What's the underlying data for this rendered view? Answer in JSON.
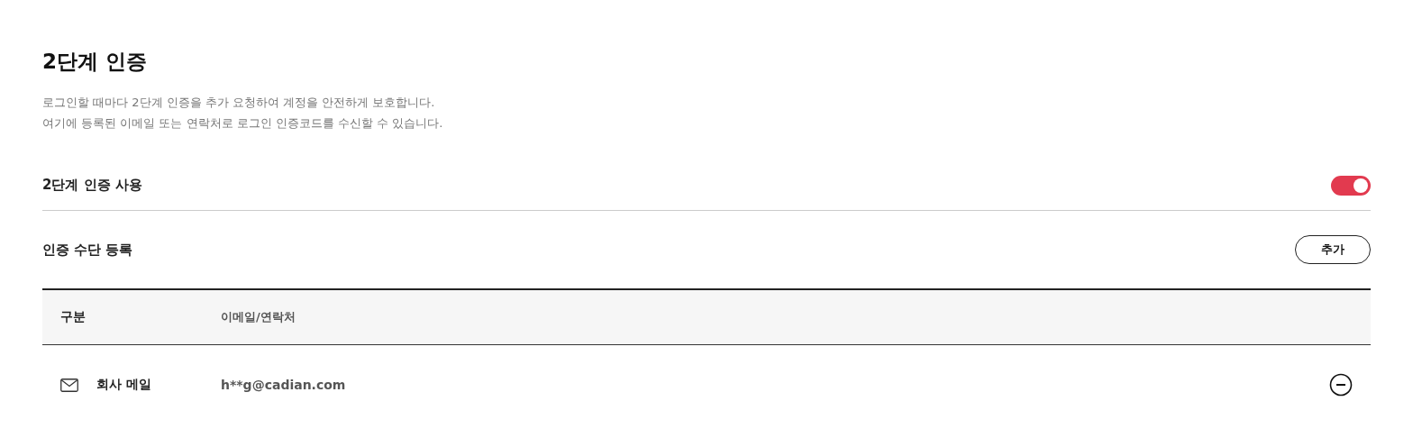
{
  "title": "2단계 인증",
  "description": [
    "로그인할 때마다 2단계 인증을 추가 요청하여 계정을 안전하게 보호합니다.",
    "여기에 등록된 이메일 또는 연락처로 로그인 인증코드를 수신할 수 있습니다."
  ],
  "two_factor": {
    "label": "2단계 인증 사용",
    "on": true
  },
  "methods": {
    "label": "인증 수단 등록",
    "add_button": "추가"
  },
  "table": {
    "columns": [
      "구분",
      "이메일/연락처"
    ],
    "rows": [
      {
        "kind": "email",
        "type": "회사 메일",
        "contact": "h**g@cadian.com"
      }
    ]
  }
}
